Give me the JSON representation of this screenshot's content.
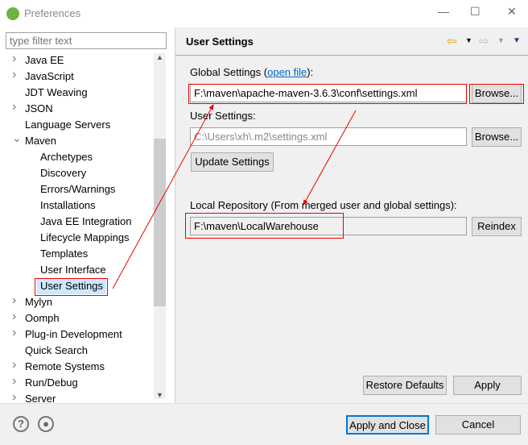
{
  "window": {
    "title": "Preferences",
    "minimize": "—",
    "maximize": "☐",
    "close": "✕"
  },
  "filter": {
    "placeholder": "type filter text"
  },
  "tree": [
    {
      "label": "Java EE",
      "chevron": ">"
    },
    {
      "label": "JavaScript",
      "chevron": ">"
    },
    {
      "label": "JDT Weaving",
      "chevron": ""
    },
    {
      "label": "JSON",
      "chevron": ">"
    },
    {
      "label": "Language Servers",
      "chevron": ""
    },
    {
      "label": "Maven",
      "chevron": "v"
    },
    {
      "label": "Archetypes",
      "child": true
    },
    {
      "label": "Discovery",
      "child": true
    },
    {
      "label": "Errors/Warnings",
      "child": true
    },
    {
      "label": "Installations",
      "child": true
    },
    {
      "label": "Java EE Integration",
      "child": true
    },
    {
      "label": "Lifecycle Mappings",
      "child": true
    },
    {
      "label": "Templates",
      "child": true
    },
    {
      "label": "User Interface",
      "child": true
    },
    {
      "label": "User Settings",
      "child": true,
      "selected": true
    },
    {
      "label": "Mylyn",
      "chevron": ">"
    },
    {
      "label": "Oomph",
      "chevron": ">"
    },
    {
      "label": "Plug-in Development",
      "chevron": ">"
    },
    {
      "label": "Quick Search",
      "chevron": ""
    },
    {
      "label": "Remote Systems",
      "chevron": ">"
    },
    {
      "label": "Run/Debug",
      "chevron": ">"
    },
    {
      "label": "Server",
      "chevron": ">"
    }
  ],
  "page": {
    "title": "User Settings",
    "global_label_pre": "Global Settings (",
    "global_link": "open file",
    "global_label_post": "):",
    "global_value": "F:\\maven\\apache-maven-3.6.3\\conf\\settings.xml",
    "browse": "Browse...",
    "user_label": "User Settings:",
    "user_value": "C:\\Users\\xh\\.m2\\settings.xml",
    "update": "Update Settings",
    "local_label": "Local Repository (From merged user and global settings):",
    "local_value": "F:\\maven\\LocalWarehouse",
    "reindex": "Reindex",
    "restore": "Restore Defaults",
    "apply": "Apply"
  },
  "footer": {
    "help": "?",
    "apply_close": "Apply and Close",
    "cancel": "Cancel"
  },
  "colors": {
    "annotation": "#ee0000",
    "accent": "#0078d7"
  }
}
